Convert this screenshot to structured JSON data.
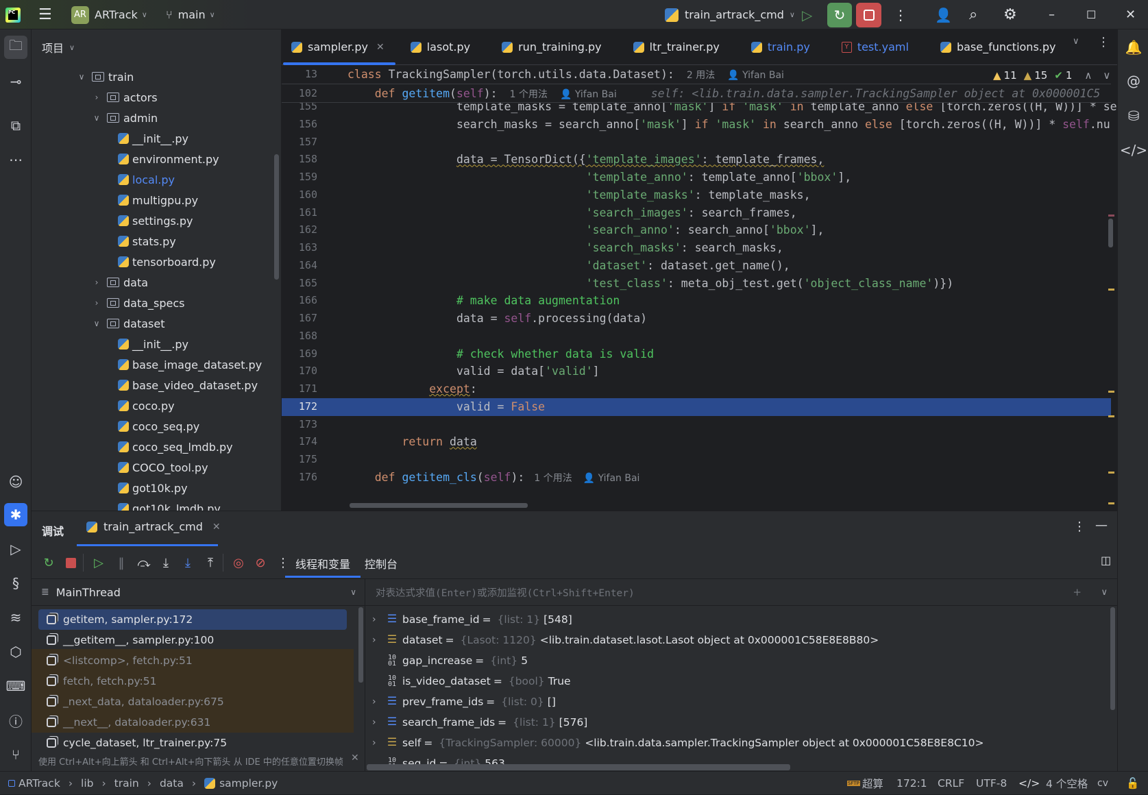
{
  "titlebar": {
    "project_badge": "AR",
    "project_name": "ARTrack",
    "branch": "main",
    "run_config": "train_artrack_cmd"
  },
  "colors": {
    "accent": "#3574f0",
    "debug_green": "#57965c",
    "stop_red": "#c94f4f",
    "current_line": "#2a4a8e"
  },
  "project_panel": {
    "title": "项目",
    "items": [
      {
        "label": "train",
        "depth": 0,
        "kind": "folder",
        "open": true
      },
      {
        "label": "actors",
        "depth": 1,
        "kind": "folder",
        "open": false
      },
      {
        "label": "admin",
        "depth": 1,
        "kind": "folder",
        "open": true
      },
      {
        "label": "__init__.py",
        "depth": 2,
        "kind": "py"
      },
      {
        "label": "environment.py",
        "depth": 2,
        "kind": "py"
      },
      {
        "label": "local.py",
        "depth": 2,
        "kind": "py",
        "modified": true
      },
      {
        "label": "multigpu.py",
        "depth": 2,
        "kind": "py"
      },
      {
        "label": "settings.py",
        "depth": 2,
        "kind": "py"
      },
      {
        "label": "stats.py",
        "depth": 2,
        "kind": "py"
      },
      {
        "label": "tensorboard.py",
        "depth": 2,
        "kind": "py"
      },
      {
        "label": "data",
        "depth": 1,
        "kind": "folder",
        "open": false
      },
      {
        "label": "data_specs",
        "depth": 1,
        "kind": "folder-plain",
        "open": false
      },
      {
        "label": "dataset",
        "depth": 1,
        "kind": "folder",
        "open": true
      },
      {
        "label": "__init__.py",
        "depth": 2,
        "kind": "py"
      },
      {
        "label": "base_image_dataset.py",
        "depth": 2,
        "kind": "py"
      },
      {
        "label": "base_video_dataset.py",
        "depth": 2,
        "kind": "py"
      },
      {
        "label": "coco.py",
        "depth": 2,
        "kind": "py"
      },
      {
        "label": "coco_seq.py",
        "depth": 2,
        "kind": "py"
      },
      {
        "label": "coco_seq_lmdb.py",
        "depth": 2,
        "kind": "py"
      },
      {
        "label": "COCO_tool.py",
        "depth": 2,
        "kind": "py"
      },
      {
        "label": "got10k.py",
        "depth": 2,
        "kind": "py"
      },
      {
        "label": "got10k_lmdb.py",
        "depth": 2,
        "kind": "py"
      }
    ]
  },
  "editor": {
    "tabs": [
      {
        "label": "sampler.py",
        "icon": "python",
        "active": true,
        "closable": true
      },
      {
        "label": "lasot.py",
        "icon": "python"
      },
      {
        "label": "run_training.py",
        "icon": "python"
      },
      {
        "label": "ltr_trainer.py",
        "icon": "python"
      },
      {
        "label": "train.py",
        "icon": "python",
        "modified": true
      },
      {
        "label": "test.yaml",
        "icon": "yaml",
        "modified": true
      },
      {
        "label": "base_functions.py",
        "icon": "python"
      }
    ],
    "inspections": {
      "warnings": "11",
      "weak_warnings": "15",
      "ok": "1"
    },
    "sticky_lines": [
      {
        "n": "13",
        "t": [
          [
            "k",
            "class "
          ],
          [
            "t",
            "TrackingSampler(torch.utils.data.Dataset):"
          ]
        ],
        "usages": "2 用法",
        "author": "Yifan Bai"
      },
      {
        "n": "102",
        "t": [
          [
            "t",
            "    "
          ],
          [
            "k",
            "def "
          ],
          [
            "f",
            "getitem"
          ],
          [
            "t",
            "("
          ],
          [
            "p",
            "self"
          ],
          [
            "t",
            "):"
          ]
        ],
        "usages": "1 个用法",
        "author": "Yifan Bai",
        "inline_value": "self: <lib.train.data.sampler.TrackingSampler object at 0x000001C5"
      }
    ],
    "current_line": "172",
    "lines": [
      {
        "n": "155",
        "t": [
          [
            "t",
            "                template_masks = template_anno["
          ],
          [
            "s",
            "'mask'"
          ],
          [
            "t",
            "] "
          ],
          [
            "k",
            "if "
          ],
          [
            "s",
            "'mask' "
          ],
          [
            "k",
            "in "
          ],
          [
            "t",
            "template_anno "
          ],
          [
            "k",
            "else "
          ],
          [
            "t",
            "[torch.zeros((H, W))] * se"
          ]
        ]
      },
      {
        "n": "156",
        "t": [
          [
            "t",
            "                search_masks = search_anno["
          ],
          [
            "s",
            "'mask'"
          ],
          [
            "t",
            "] "
          ],
          [
            "k",
            "if "
          ],
          [
            "s",
            "'mask' "
          ],
          [
            "k",
            "in "
          ],
          [
            "t",
            "search_anno "
          ],
          [
            "k",
            "else "
          ],
          [
            "t",
            "[torch.zeros((H, W))] * "
          ],
          [
            "p",
            "self"
          ],
          [
            "t",
            ".nu"
          ]
        ]
      },
      {
        "n": "157",
        "t": []
      },
      {
        "n": "158",
        "t": [
          [
            "t",
            "                "
          ],
          [
            "tw",
            "data = TensorDict({"
          ],
          [
            "sw",
            "'template_images'"
          ],
          [
            "tw",
            ": template_frames,"
          ]
        ]
      },
      {
        "n": "159",
        "t": [
          [
            "t",
            "                                   "
          ],
          [
            "s",
            "'template_anno'"
          ],
          [
            "t",
            ": template_anno["
          ],
          [
            "s",
            "'bbox'"
          ],
          [
            "t",
            "],"
          ]
        ]
      },
      {
        "n": "160",
        "t": [
          [
            "t",
            "                                   "
          ],
          [
            "s",
            "'template_masks'"
          ],
          [
            "t",
            ": template_masks,"
          ]
        ]
      },
      {
        "n": "161",
        "t": [
          [
            "t",
            "                                   "
          ],
          [
            "s",
            "'search_images'"
          ],
          [
            "t",
            ": search_frames,"
          ]
        ]
      },
      {
        "n": "162",
        "t": [
          [
            "t",
            "                                   "
          ],
          [
            "s",
            "'search_anno'"
          ],
          [
            "t",
            ": search_anno["
          ],
          [
            "s",
            "'bbox'"
          ],
          [
            "t",
            "],"
          ]
        ]
      },
      {
        "n": "163",
        "t": [
          [
            "t",
            "                                   "
          ],
          [
            "s",
            "'search_masks'"
          ],
          [
            "t",
            ": search_masks,"
          ]
        ]
      },
      {
        "n": "164",
        "t": [
          [
            "t",
            "                                   "
          ],
          [
            "s",
            "'dataset'"
          ],
          [
            "t",
            ": dataset.get_name(),"
          ]
        ]
      },
      {
        "n": "165",
        "t": [
          [
            "t",
            "                                   "
          ],
          [
            "s",
            "'test_class'"
          ],
          [
            "t",
            ": meta_obj_test.get("
          ],
          [
            "s",
            "'object_class_name'"
          ],
          [
            "t",
            ")})"
          ]
        ]
      },
      {
        "n": "166",
        "t": [
          [
            "t",
            "                "
          ],
          [
            "c",
            "# make data augmentation"
          ]
        ]
      },
      {
        "n": "167",
        "t": [
          [
            "t",
            "                data = "
          ],
          [
            "p",
            "self"
          ],
          [
            "t",
            ".processing(data)"
          ]
        ]
      },
      {
        "n": "168",
        "t": []
      },
      {
        "n": "169",
        "t": [
          [
            "t",
            "                "
          ],
          [
            "c",
            "# check whether data is valid"
          ]
        ]
      },
      {
        "n": "170",
        "t": [
          [
            "t",
            "                valid = data["
          ],
          [
            "s",
            "'valid'"
          ],
          [
            "t",
            "]"
          ]
        ]
      },
      {
        "n": "171",
        "t": [
          [
            "t",
            "            "
          ],
          [
            "kw",
            "except"
          ],
          [
            "t",
            ":"
          ]
        ]
      },
      {
        "n": "172",
        "t": [
          [
            "t",
            "                valid = "
          ],
          [
            "k",
            "False"
          ]
        ]
      },
      {
        "n": "173",
        "t": []
      },
      {
        "n": "174",
        "t": [
          [
            "t",
            "        "
          ],
          [
            "k",
            "return "
          ],
          [
            "tw",
            "data"
          ]
        ]
      },
      {
        "n": "175",
        "t": []
      },
      {
        "n": "176",
        "t": [
          [
            "t",
            "    "
          ],
          [
            "k",
            "def "
          ],
          [
            "f",
            "getitem_cls"
          ],
          [
            "t",
            "("
          ],
          [
            "p",
            "self"
          ],
          [
            "t",
            "):"
          ]
        ],
        "usages": "1 个用法",
        "author": "Yifan Bai"
      }
    ]
  },
  "debug": {
    "title": "调试",
    "session_tab": "train_artrack_cmd",
    "tabs": [
      {
        "label": "线程和变量",
        "active": true
      },
      {
        "label": "控制台"
      }
    ],
    "thread": "MainThread",
    "frames": [
      {
        "label": "getitem, sampler.py:172",
        "state": "selected"
      },
      {
        "label": "__getitem__, sampler.py:100",
        "state": "normal"
      },
      {
        "label": "<listcomp>, fetch.py:51",
        "state": "library"
      },
      {
        "label": "fetch, fetch.py:51",
        "state": "library"
      },
      {
        "label": "_next_data, dataloader.py:675",
        "state": "library"
      },
      {
        "label": "__next__, dataloader.py:631",
        "state": "library"
      },
      {
        "label": "cycle_dataset, ltr_trainer.py:75",
        "state": "normal"
      }
    ],
    "frames_hint": "使用 Ctrl+Alt+向上箭头 和 Ctrl+Alt+向下箭头 从 IDE 中的任意位置切换帧",
    "expression_placeholder": "对表达式求值(Enter)或添加监视(Ctrl+Shift+Enter)",
    "variables": [
      {
        "name": "base_frame_id",
        "type": "{list: 1}",
        "value": "[548]",
        "icon": "list",
        "expandable": true
      },
      {
        "name": "dataset",
        "type": "{Lasot: 1120}",
        "value": "<lib.train.dataset.lasot.Lasot object at 0x000001C58E8E8B80>",
        "icon": "object",
        "expandable": true
      },
      {
        "name": "gap_increase",
        "type": "{int}",
        "value": "5",
        "icon": "primitive",
        "expandable": false
      },
      {
        "name": "is_video_dataset",
        "type": "{bool}",
        "value": "True",
        "icon": "primitive",
        "expandable": false
      },
      {
        "name": "prev_frame_ids",
        "type": "{list: 0}",
        "value": "[]",
        "icon": "list",
        "expandable": true
      },
      {
        "name": "search_frame_ids",
        "type": "{list: 1}",
        "value": "[576]",
        "icon": "list",
        "expandable": true
      },
      {
        "name": "self",
        "type": "{TrackingSampler: 60000}",
        "value": "<lib.train.data.sampler.TrackingSampler object at 0x000001C58E8E8C10>",
        "icon": "object",
        "expandable": true
      },
      {
        "name": "seq_id",
        "type": "{int}",
        "value": "563",
        "icon": "primitive",
        "expandable": false
      }
    ]
  },
  "statusbar": {
    "breadcrumb": [
      "ARTrack",
      "lib",
      "train",
      "data",
      "sampler.py"
    ],
    "sftp_label": "SFTP",
    "remote": "超算",
    "position": "172:1",
    "line_sep": "CRLF",
    "encoding": "UTF-8",
    "indent": "4 个空格",
    "interpreter": "cv"
  }
}
